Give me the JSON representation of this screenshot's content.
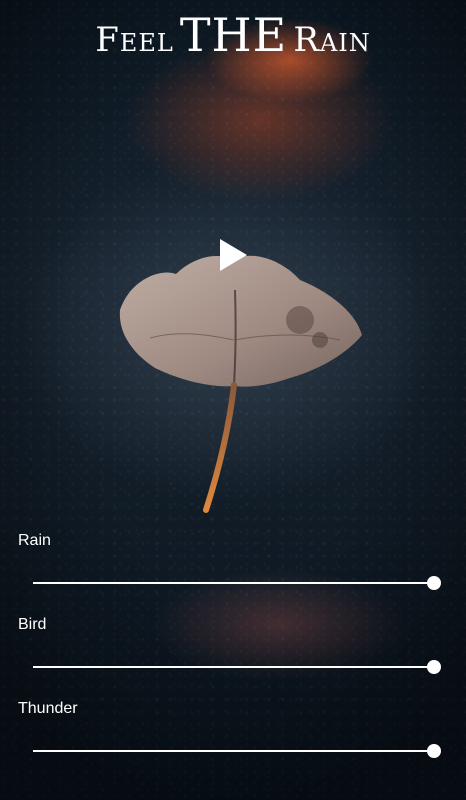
{
  "app": {
    "title_word1": "Feel",
    "title_word2": "THE",
    "title_word3": "Rain"
  },
  "player": {
    "play_icon": "play-icon"
  },
  "controls": [
    {
      "label": "Rain",
      "value": 1.0
    },
    {
      "label": "Bird",
      "value": 1.0
    },
    {
      "label": "Thunder",
      "value": 1.0
    }
  ],
  "colors": {
    "text": "#ffffff",
    "accent_reflection": "#d65c30",
    "background": "#0b1722"
  }
}
